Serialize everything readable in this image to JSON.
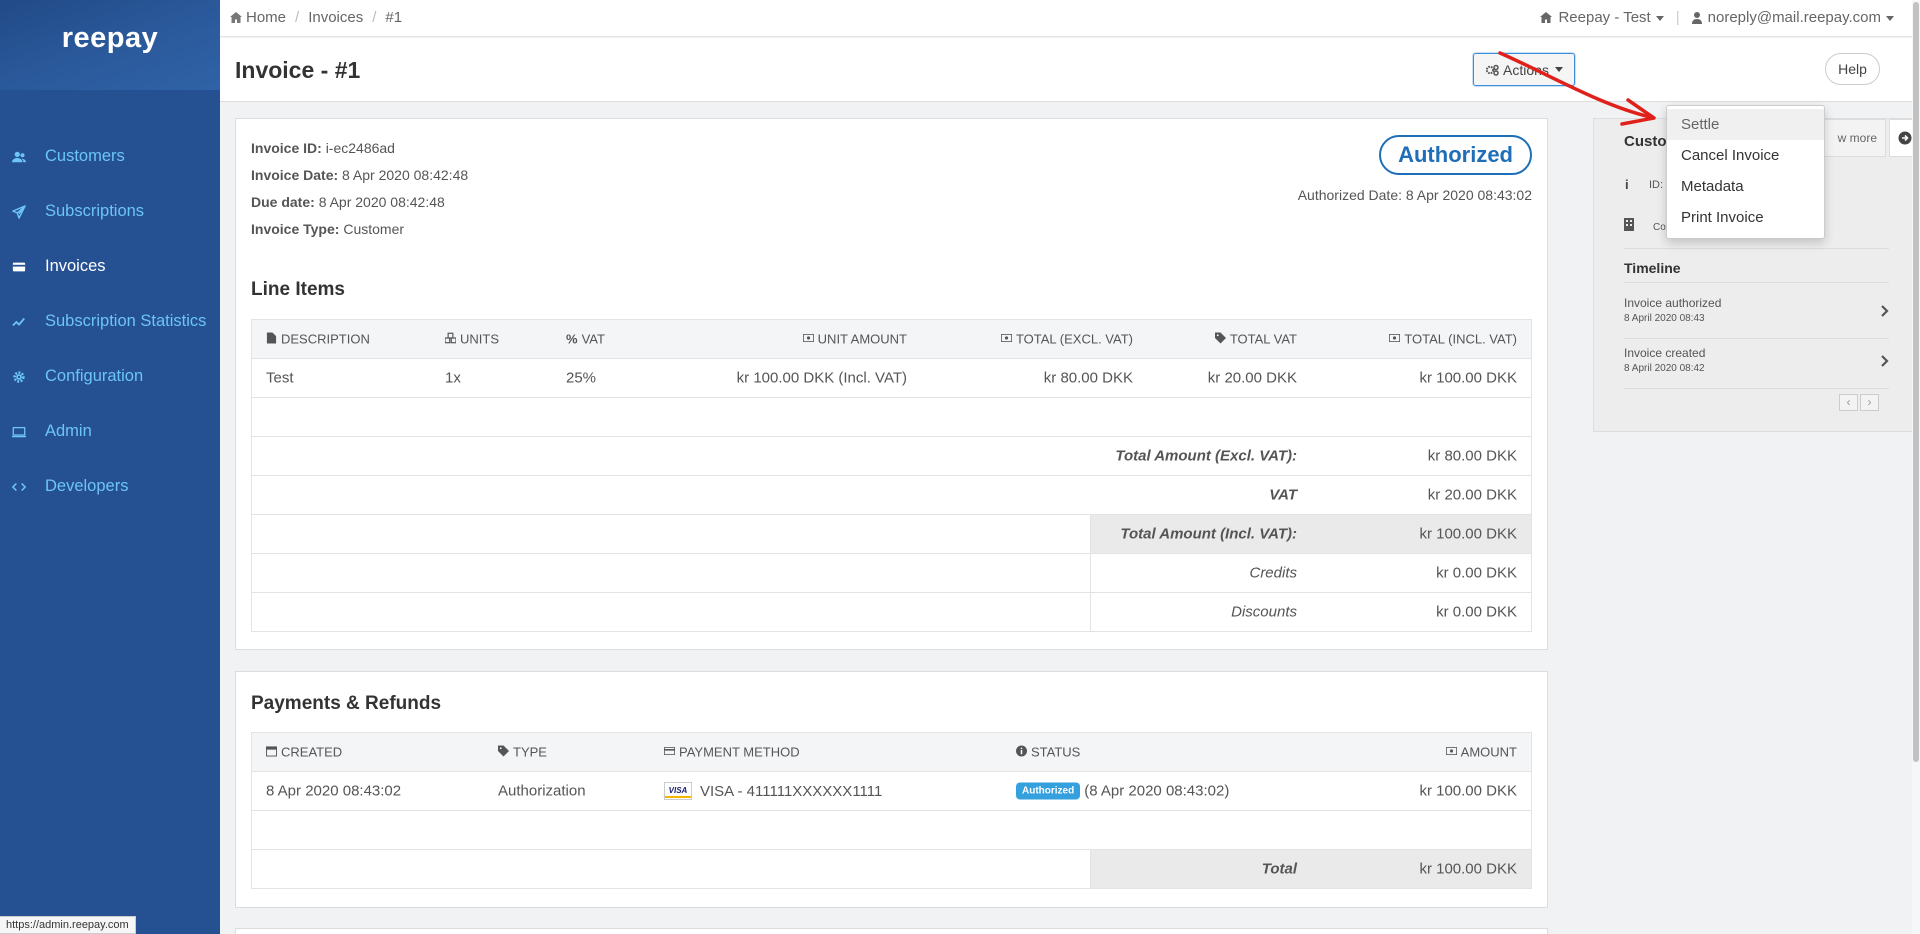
{
  "app": {
    "logo": "reepay",
    "status_url": "https://admin.reepay.com"
  },
  "sidebar": {
    "items": [
      {
        "label": "Customers",
        "icon": "users-icon",
        "active": false
      },
      {
        "label": "Subscriptions",
        "icon": "paper-plane-icon",
        "active": false
      },
      {
        "label": "Invoices",
        "icon": "credit-card-icon",
        "active": true
      },
      {
        "label": "Subscription Statistics",
        "icon": "line-chart-icon",
        "active": false
      },
      {
        "label": "Configuration",
        "icon": "gear-icon",
        "active": false
      },
      {
        "label": "Admin",
        "icon": "monitor-icon",
        "active": false
      },
      {
        "label": "Developers",
        "icon": "code-icon",
        "active": false
      }
    ]
  },
  "topbar": {
    "breadcrumb": [
      "Home",
      "Invoices",
      "#1"
    ],
    "account": "Reepay - Test",
    "user": "noreply@mail.reepay.com"
  },
  "header": {
    "title": "Invoice - #1",
    "actions_label": "Actions",
    "help_label": "Help"
  },
  "actions_menu": [
    "Settle",
    "Cancel Invoice",
    "Metadata",
    "Print Invoice"
  ],
  "invoice": {
    "id_label": "Invoice ID:",
    "id": "i-ec2486ad",
    "date_label": "Invoice Date:",
    "date": "8 Apr 2020 08:42:48",
    "due_label": "Due date:",
    "due": "8 Apr 2020 08:42:48",
    "type_label": "Invoice Type:",
    "type": "Customer",
    "status": "Authorized",
    "authorized_date": "Authorized Date: 8 Apr 2020 08:43:02"
  },
  "line_items": {
    "title": "Line Items",
    "headers": [
      "DESCRIPTION",
      "UNITS",
      "VAT",
      "UNIT AMOUNT",
      "TOTAL (EXCL. VAT)",
      "TOTAL VAT",
      "TOTAL (INCL. VAT)"
    ],
    "rows": [
      {
        "description": "Test",
        "units": "1x",
        "vat": "25%",
        "unit_amount": "kr 100.00 DKK (Incl. VAT)",
        "total_excl": "kr 80.00 DKK",
        "total_vat": "kr 20.00 DKK",
        "total_incl": "kr 100.00 DKK"
      }
    ],
    "totals": [
      {
        "label": "Total Amount (Excl. VAT):",
        "value": "kr 80.00 DKK"
      },
      {
        "label": "VAT",
        "value": "kr 20.00 DKK"
      },
      {
        "label": "Total Amount (Incl. VAT):",
        "value": "kr 100.00 DKK"
      },
      {
        "label": "Credits",
        "value": "kr 0.00 DKK"
      },
      {
        "label": "Discounts",
        "value": "kr 0.00 DKK"
      }
    ]
  },
  "payments": {
    "title": "Payments & Refunds",
    "headers": [
      "CREATED",
      "TYPE",
      "PAYMENT METHOD",
      "STATUS",
      "AMOUNT"
    ],
    "rows": [
      {
        "created": "8 Apr 2020 08:43:02",
        "type": "Authorization",
        "card_brand": "VISA",
        "method": "VISA - 411111XXXXXX1111",
        "status_badge": "Authorized",
        "status_date": "(8 Apr 2020 08:43:02)",
        "amount": "kr 100.00 DKK"
      }
    ],
    "total_label": "Total",
    "total_value": "kr 100.00 DKK"
  },
  "customer_panel": {
    "title": "Custo",
    "view_more": "w more",
    "id_label": "ID:",
    "company_label": "Co",
    "timeline_title": "Timeline",
    "timeline": [
      {
        "title": "Invoice authorized",
        "date": "8 April 2020 08:43"
      },
      {
        "title": "Invoice created",
        "date": "8 April 2020 08:42"
      }
    ],
    "prev": "‹",
    "next": "›"
  }
}
